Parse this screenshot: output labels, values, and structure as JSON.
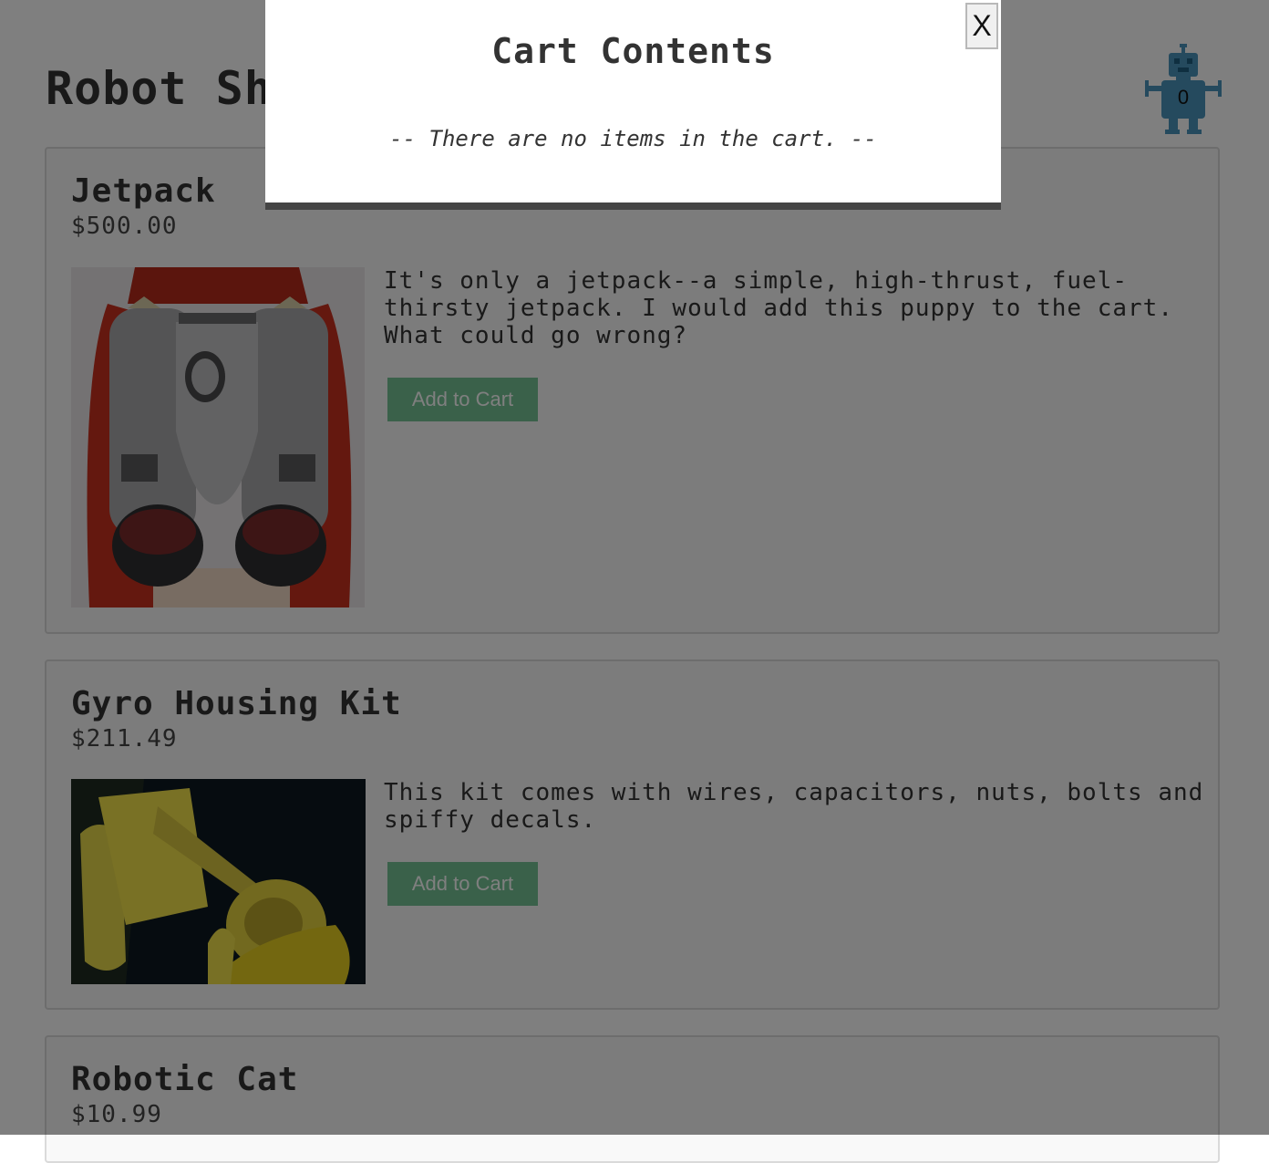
{
  "header": {
    "title": "Robot Shop",
    "cart_count": "0"
  },
  "products": [
    {
      "name": "Jetpack",
      "price": "$500.00",
      "description": "It's only a jetpack--a simple, high-thrust, fuel-thirsty jetpack. I would add this puppy to the cart. What could go wrong?",
      "button_label": "Add to Cart"
    },
    {
      "name": "Gyro Housing Kit",
      "price": "$211.49",
      "description": "This kit comes with wires, capacitors, nuts, bolts and spiffy decals.",
      "button_label": "Add to Cart"
    },
    {
      "name": "Robotic Cat",
      "price": "$10.99"
    }
  ],
  "cart_modal": {
    "title": "Cart Contents",
    "empty_message": "-- There are no items in the cart. --",
    "close_label": "X"
  },
  "colors": {
    "add_button": "#75c394",
    "robot_icon": "#4a95bd",
    "overlay": "rgba(0,0,0,0.5)"
  }
}
